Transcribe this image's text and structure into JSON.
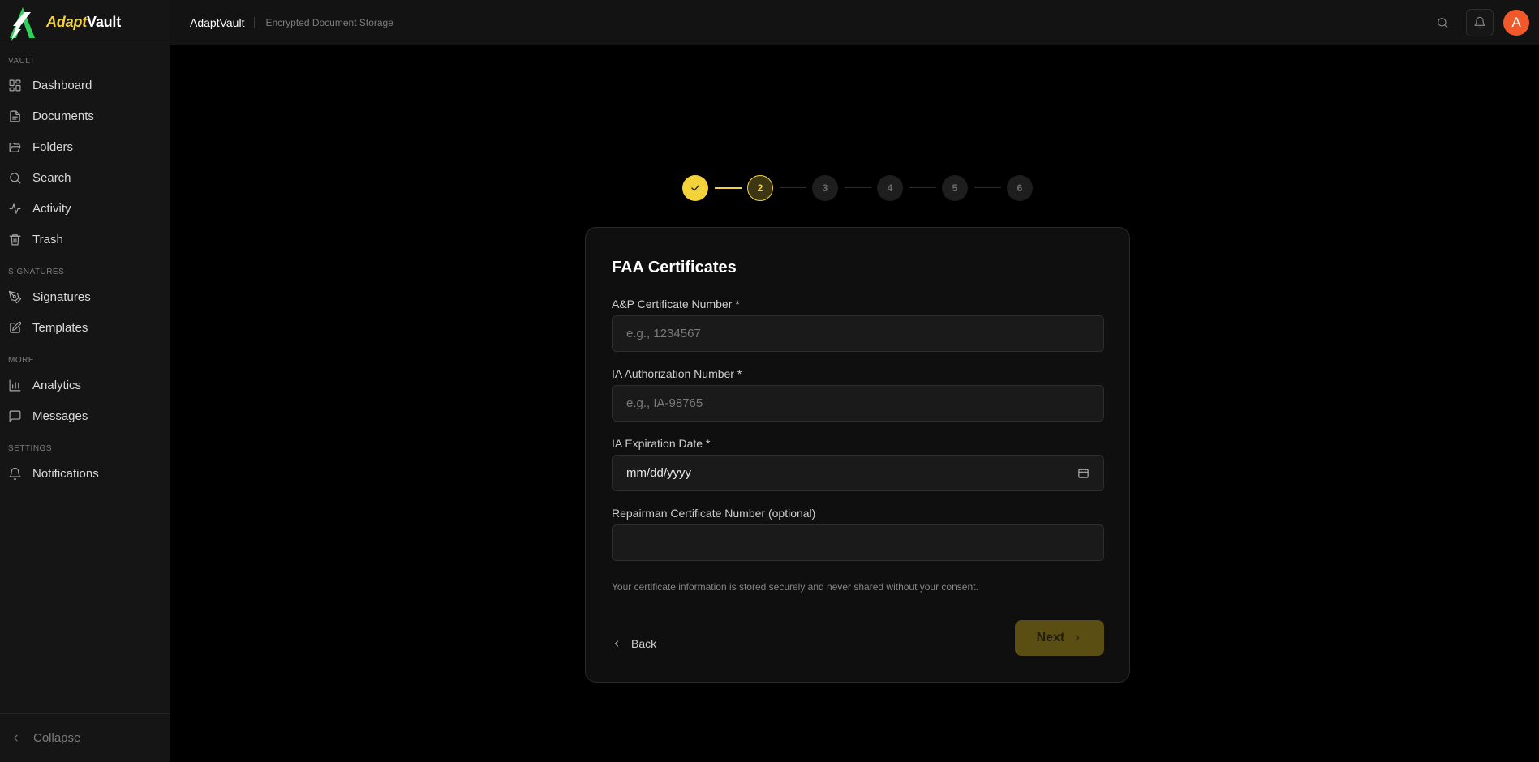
{
  "brand": {
    "name_part1": "Adapt",
    "name_part2": "Vault"
  },
  "header": {
    "app_name": "AdaptVault",
    "subtitle": "Encrypted Document Storage",
    "avatar_initial": "A"
  },
  "sidebar": {
    "sections": [
      {
        "label": "VAULT",
        "items": [
          "Dashboard",
          "Documents",
          "Folders",
          "Search",
          "Activity",
          "Trash"
        ]
      },
      {
        "label": "SIGNATURES",
        "items": [
          "Signatures",
          "Templates"
        ]
      },
      {
        "label": "MORE",
        "items": [
          "Analytics",
          "Messages"
        ]
      },
      {
        "label": "SETTINGS",
        "items": [
          "Notifications"
        ]
      }
    ],
    "collapse_label": "Collapse"
  },
  "stepper": {
    "steps": [
      "",
      "2",
      "3",
      "4",
      "5",
      "6"
    ],
    "current": 2
  },
  "form": {
    "title": "FAA Certificates",
    "fields": [
      {
        "label": "A&P Certificate Number *",
        "placeholder": "e.g., 1234567",
        "value": ""
      },
      {
        "label": "IA Authorization Number *",
        "placeholder": "e.g., IA-98765",
        "value": ""
      },
      {
        "label": "IA Expiration Date *",
        "placeholder": "",
        "value": "mm/dd/yyyy"
      },
      {
        "label": "Repairman Certificate Number (optional)",
        "placeholder": "",
        "value": ""
      }
    ],
    "note": "Your certificate information is stored securely and never shared without your consent.",
    "back_label": "Back",
    "next_label": "Next"
  }
}
